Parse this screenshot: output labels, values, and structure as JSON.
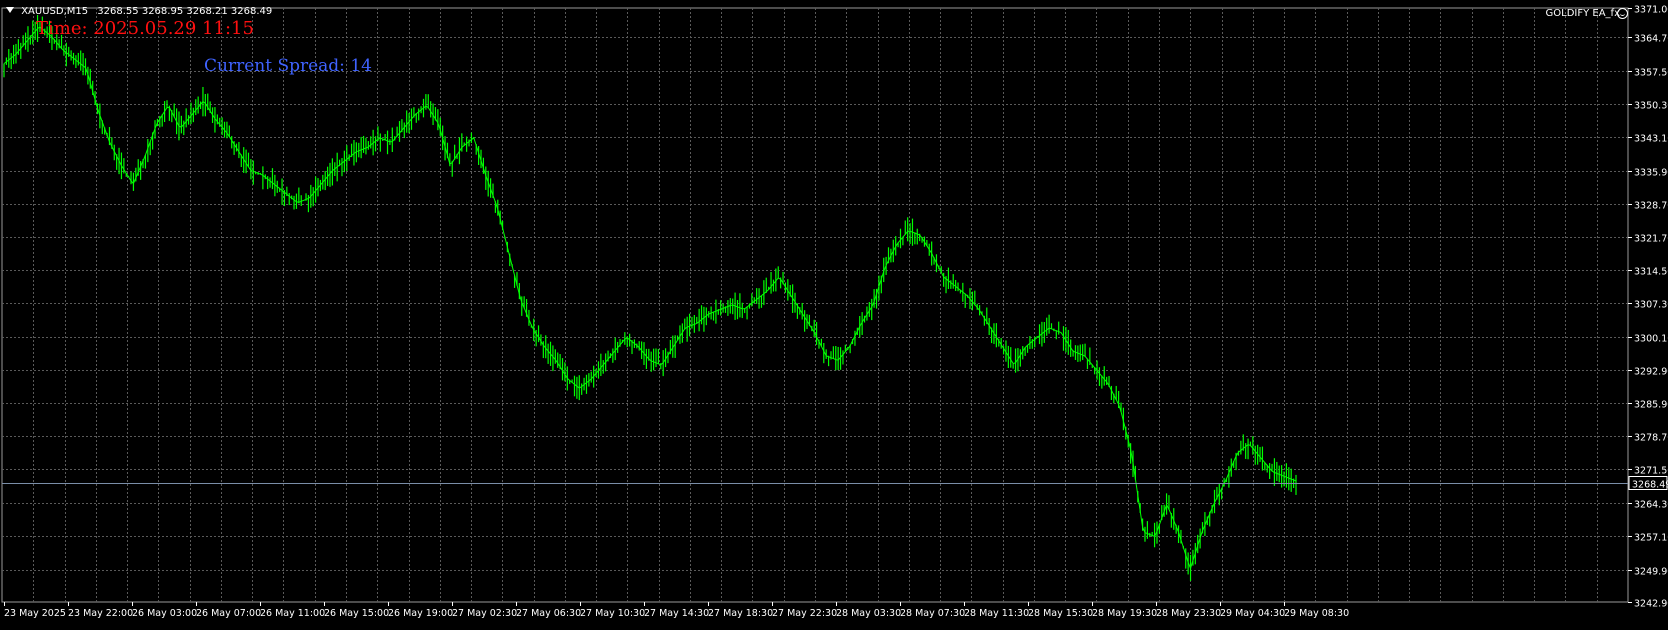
{
  "header": {
    "symbol": "XAUUSD,M15",
    "ohlc": "3268.55 3268.95 3268.21 3268.49"
  },
  "overlay": {
    "time_text": "Time: 2025.05.29 11:15",
    "spread_text": "Current Spread: 14"
  },
  "expert": {
    "label": "GOLDIFY EA_fx"
  },
  "colors": {
    "background": "#000000",
    "grid": "#5a5a5a",
    "candle": "#00ff00",
    "time_label": "#ff1010",
    "spread_label": "#3f63ff",
    "bid_line": "#7a8ea8",
    "axis_text": "#ffffff"
  },
  "chart_data": {
    "type": "line",
    "instrument": "XAUUSD",
    "timeframe": "M15",
    "current_price_label": "3268.49",
    "current_price": 3268.49,
    "y_ticks": [
      3371.0,
      3364.7,
      3357.5,
      3350.3,
      3343.1,
      3335.9,
      3328.7,
      3321.7,
      3314.5,
      3307.3,
      3300.1,
      3292.9,
      3285.9,
      3278.7,
      3271.5,
      3264.3,
      3257.1,
      3249.9,
      3242.9
    ],
    "y_tick_labels": [
      "3371.00",
      "3364.70",
      "3357.50",
      "3350.30",
      "3343.10",
      "3335.90",
      "3328.70",
      "3321.70",
      "3314.50",
      "3307.30",
      "3300.10",
      "3292.90",
      "3285.90",
      "3278.70",
      "3271.50",
      "3264.30",
      "3257.10",
      "3249.90",
      "3242.90"
    ],
    "ylim": [
      3242.9,
      3371.0
    ],
    "x_tick_labels": [
      "23 May 2025",
      "23 May 22:00",
      "26 May 03:00",
      "26 May 07:00",
      "26 May 11:00",
      "26 May 15:00",
      "26 May 19:00",
      "27 May 02:30",
      "27 May 06:30",
      "27 May 10:30",
      "27 May 14:30",
      "27 May 18:30",
      "27 May 22:30",
      "28 May 03:30",
      "28 May 07:30",
      "28 May 11:30",
      "28 May 15:30",
      "28 May 19:30",
      "28 May 23:30",
      "29 May 04:30",
      "29 May 08:30"
    ],
    "grid": true,
    "series": [
      {
        "values": [
          3359,
          3361,
          3364,
          3367,
          3365,
          3362,
          3360,
          3358,
          3349,
          3342,
          3337,
          3333,
          3339,
          3346,
          3350,
          3345,
          3348,
          3351,
          3347,
          3344,
          3340,
          3336,
          3335,
          3333,
          3331,
          3329,
          3330,
          3333,
          3336,
          3338,
          3340,
          3341,
          3343,
          3342,
          3345,
          3348,
          3350,
          3346,
          3337,
          3341,
          3343,
          3335,
          3328,
          3318,
          3308,
          3302,
          3298,
          3295,
          3291,
          3289,
          3291,
          3294,
          3297,
          3300,
          3298,
          3295,
          3294,
          3298,
          3302,
          3303,
          3305,
          3306,
          3307,
          3306,
          3308,
          3310,
          3313,
          3309,
          3305,
          3301,
          3296,
          3295,
          3298,
          3303,
          3307,
          3315,
          3320,
          3323,
          3322,
          3318,
          3313,
          3311,
          3309,
          3306,
          3302,
          3298,
          3294,
          3298,
          3300,
          3302,
          3301,
          3297,
          3296,
          3293,
          3290,
          3285,
          3275,
          3258,
          3257,
          3264,
          3258,
          3250,
          3258,
          3264,
          3269,
          3275,
          3277,
          3274,
          3271,
          3270,
          3269
        ]
      }
    ]
  }
}
